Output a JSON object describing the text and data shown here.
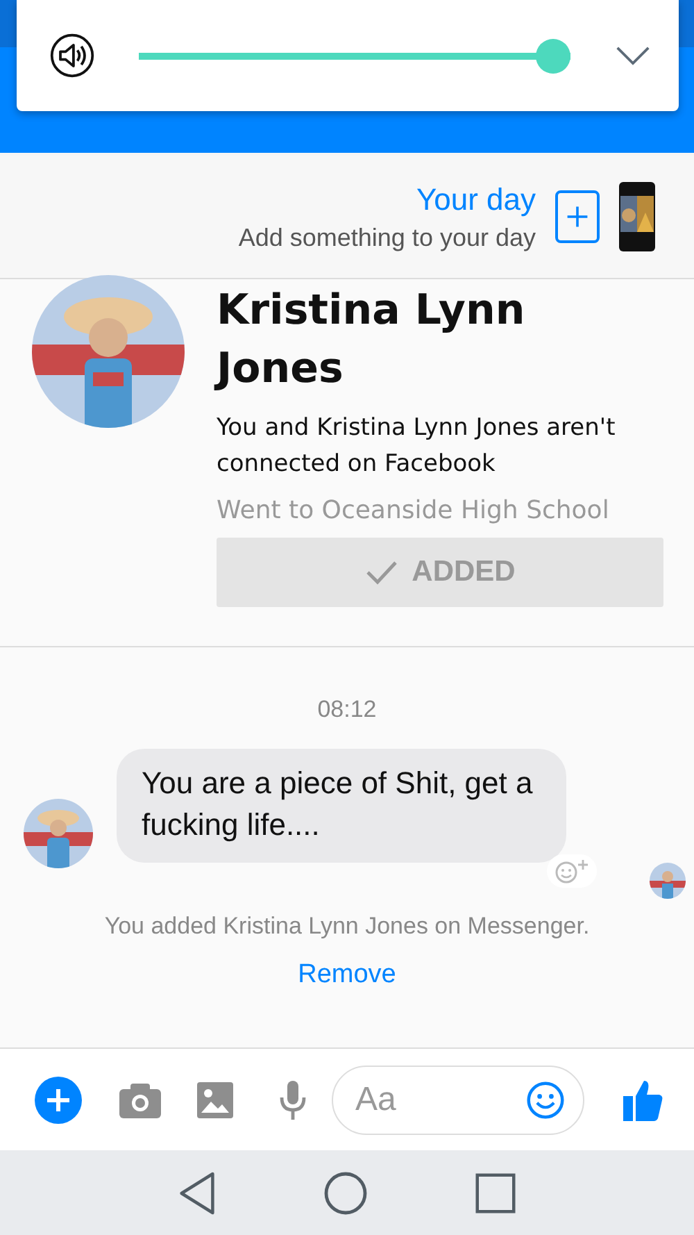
{
  "volume_panel": {
    "level": 1.0
  },
  "story": {
    "title": "Your day",
    "subtitle": "Add something to your day"
  },
  "profile": {
    "name": "Kristina Lynn Jones",
    "connection": "You and Kristina Lynn Jones aren't connected on Facebook",
    "school": "Went to Oceanside High School",
    "added_button": {
      "label": "ADDED",
      "disabled": true
    }
  },
  "chat": {
    "time": "08:12",
    "messages": [
      {
        "text": "You are a piece of Shit, get a fucking life...."
      }
    ],
    "notice": "You added Kristina Lynn Jones on Messenger.",
    "remove_link": "Remove"
  },
  "composer": {
    "placeholder": "Aa"
  }
}
